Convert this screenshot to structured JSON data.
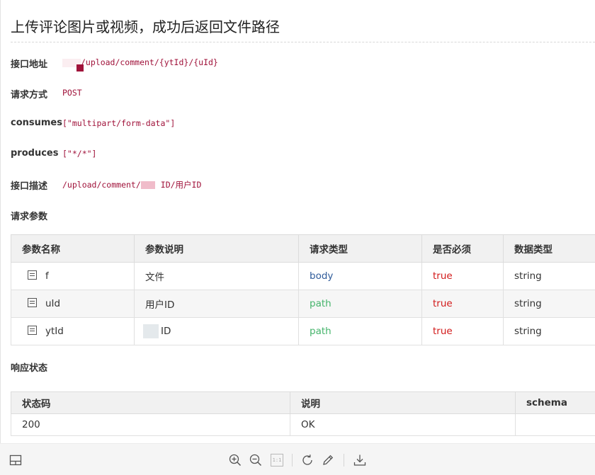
{
  "document": {
    "title": "上传评论图片或视频，成功后返回文件路径",
    "fields": {
      "endpoint": {
        "label": "接口地址",
        "value": "/upload/comment/{ytId}/{uId}"
      },
      "method": {
        "label": "请求方式",
        "value": "POST"
      },
      "consumes": {
        "label": "consumes",
        "value": "[\"multipart/form-data\"]"
      },
      "produces": {
        "label": "produces",
        "value": "[\"*/*\"]"
      },
      "description": {
        "label": "接口描述",
        "prefix": "/upload/comment/",
        "suffix": "ID/用户ID"
      }
    },
    "params_section": "请求参数",
    "params_table": {
      "headers": [
        "参数名称",
        "参数说明",
        "请求类型",
        "是否必须",
        "数据类型"
      ],
      "rows": [
        {
          "name": "f",
          "desc": "文件",
          "in": "body",
          "required": "true",
          "type": "string"
        },
        {
          "name": "uId",
          "desc": "用户ID",
          "in": "path",
          "required": "true",
          "type": "string"
        },
        {
          "name": "ytId",
          "desc": "ID",
          "in": "path",
          "required": "true",
          "type": "string"
        }
      ]
    },
    "status_section": "响应状态",
    "status_table": {
      "headers": [
        "状态码",
        "说明",
        "schema"
      ],
      "rows": [
        {
          "code": "200",
          "desc": "OK",
          "schema": ""
        }
      ]
    }
  },
  "toolbar": {
    "icons": [
      "sidebar-toggle-icon",
      "zoom-in-icon",
      "zoom-out-icon",
      "actual-size-icon",
      "rotate-icon",
      "edit-icon",
      "download-icon"
    ],
    "actual_size_label": "1:1"
  },
  "colors": {
    "code": "#a0123a",
    "body": "#2f5b9a",
    "path": "#45b46b",
    "true": "#d21919",
    "header_bg": "#f1f1f1"
  }
}
